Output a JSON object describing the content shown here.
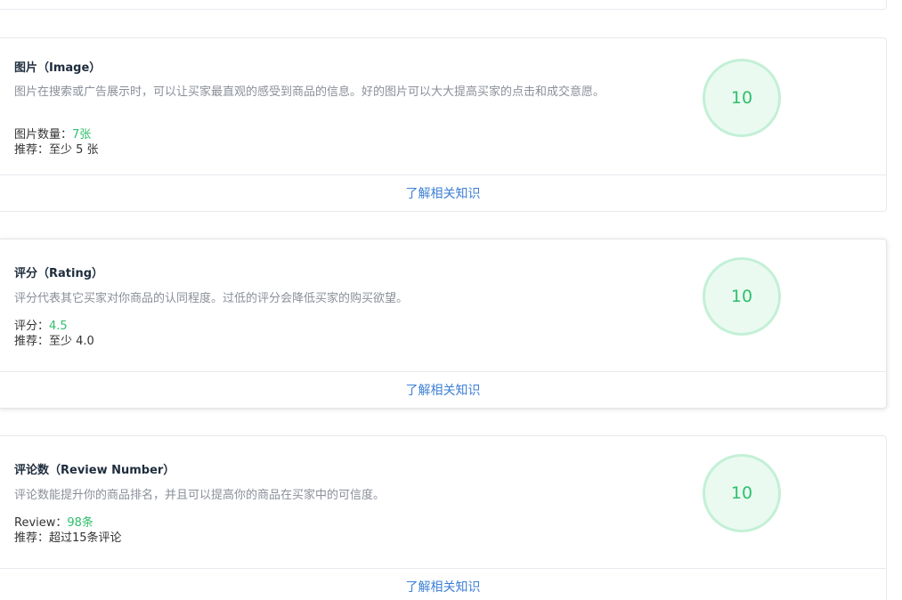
{
  "cards": [
    {
      "title": "图片（Image）",
      "description": "图片在搜索或广告展示时，可以让买家最直观的感受到商品的信息。好的图片可以大大提高买家的点击和成交意愿。",
      "metric_label": "图片数量：",
      "metric_value": "7张",
      "recommend": "推荐：至少 5 张",
      "score": "10",
      "link": "了解相关知识"
    },
    {
      "title": "评分（Rating）",
      "description": "评分代表其它买家对你商品的认同程度。过低的评分会降低买家的购买欲望。",
      "metric_label": "评分：",
      "metric_value": "4.5",
      "recommend": "推荐：至少 4.0",
      "score": "10",
      "link": "了解相关知识"
    },
    {
      "title": "评论数（Review Number）",
      "description": "评论数能提升你的商品排名，并且可以提高你的商品在买家中的可信度。",
      "metric_label": "Review：",
      "metric_value": "98条",
      "recommend": "推荐：超过15条评论",
      "score": "10",
      "link": "了解相关知识"
    }
  ],
  "colors": {
    "accent_green": "#2fbf6c",
    "link_blue": "#3d7fd4",
    "circle_fill": "#eafaf1",
    "circle_border": "#c3f0d6"
  }
}
